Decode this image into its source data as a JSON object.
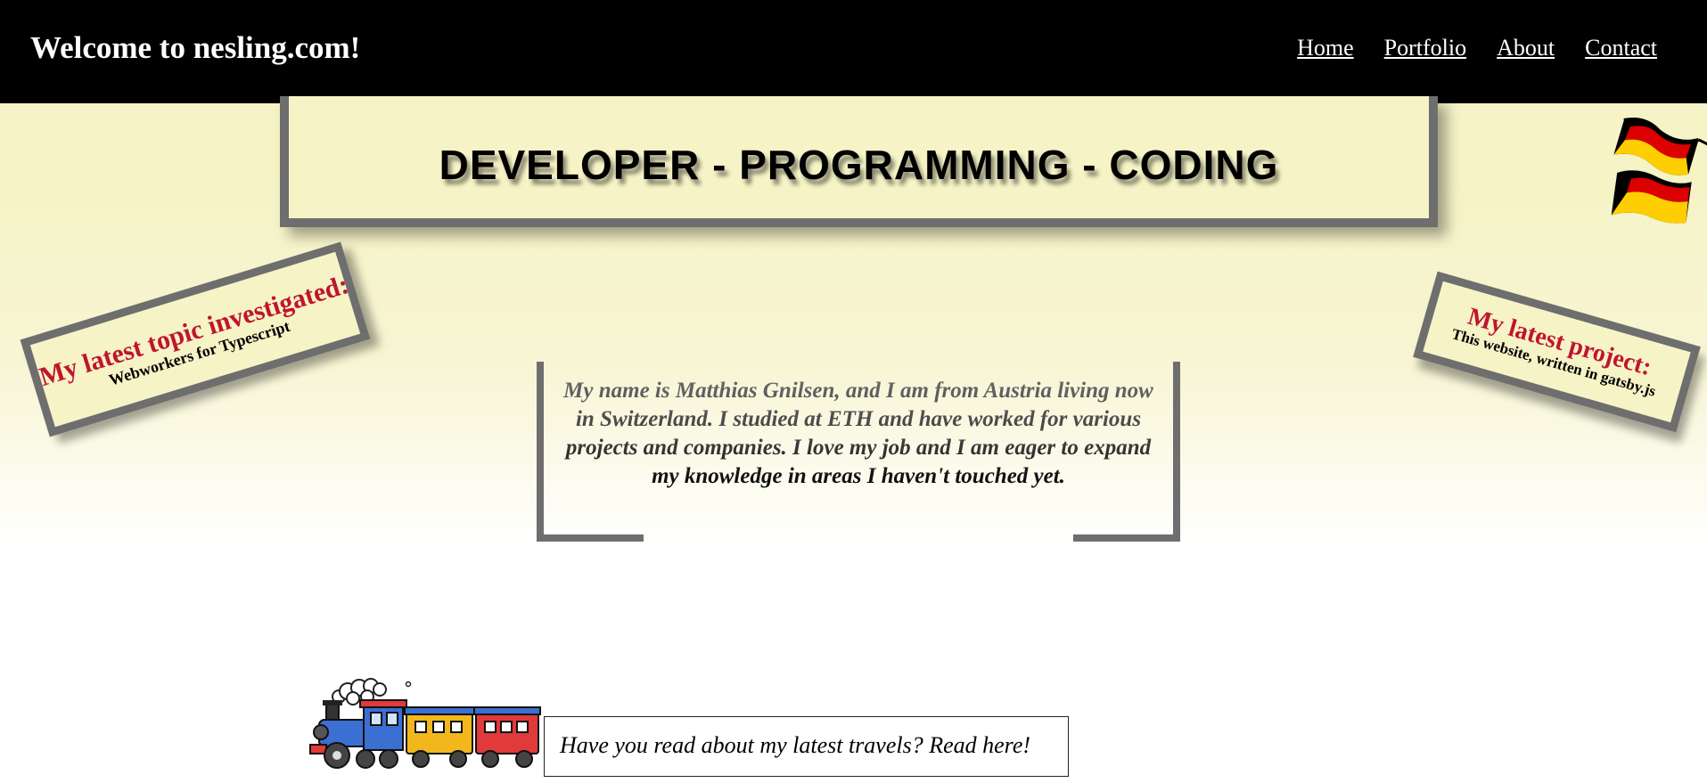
{
  "header": {
    "title": "Welcome to nesling.com!",
    "nav": [
      "Home",
      "Portfolio",
      "About",
      "Contact"
    ]
  },
  "banner": {
    "text": "DEVELOPER - PROGRAMMING - CODING"
  },
  "topic_card": {
    "heading": "My latest topic investigated:",
    "sub": "Webworkers for Typescript"
  },
  "project_card": {
    "heading": "My latest project:",
    "sub": "This website, written in gatsby.js"
  },
  "intro": {
    "text": "My name is Matthias Gnilsen, and I am from Austria living now in Switzerland. I studied at ETH and have worked for various projects and companies. I love my job and I am eager to expand my knowledge in areas I haven't touched yet."
  },
  "travel": {
    "text": "Have you read about my latest travels? Read here!"
  },
  "icons": {
    "flag": "german-flag-icon",
    "train": "train-icon"
  },
  "colors": {
    "header_bg": "#000000",
    "accent_red": "#c0152e",
    "border_gray": "#6f6e6e",
    "cream": "#f6f3c6"
  }
}
